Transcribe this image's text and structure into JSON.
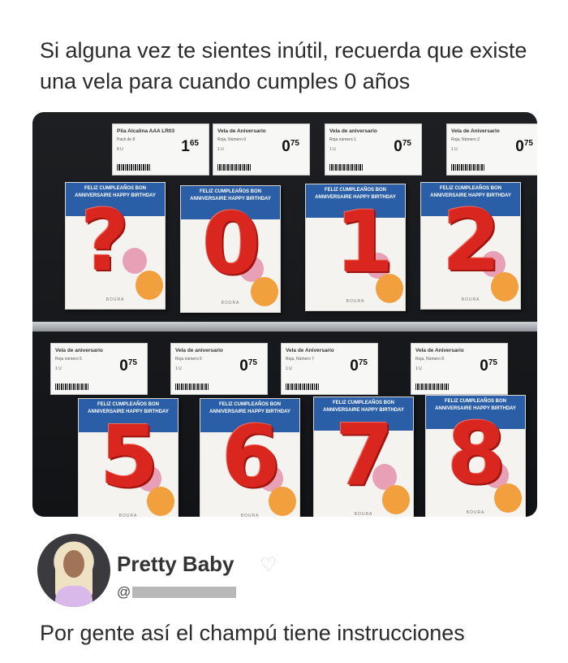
{
  "post": {
    "caption": "Si alguna vez te sientes inútil, recuerda que existe una vela para cuando cumples 0 años"
  },
  "photo": {
    "top_row_tags": [
      {
        "name": "Pila Alcalina AAA LR03",
        "line1": "Pack de 8",
        "line2": "8 U",
        "price": "1",
        "cents": "65"
      },
      {
        "name": "Vela de Aniversario",
        "line1": "Roja, Número 0",
        "line2": "1 U",
        "price": "0",
        "cents": "75"
      },
      {
        "name": "Vela de aniversario",
        "line1": "Roja número 1",
        "line2": "1 U",
        "price": "0",
        "cents": "75"
      },
      {
        "name": "Vela de Aniversario",
        "line1": "Roja, Número 2",
        "line2": "1 U",
        "price": "0",
        "cents": "75"
      }
    ],
    "bottom_row_tags": [
      {
        "name": "Vela de aniversario",
        "line1": "Roja número 5",
        "line2": "1 U",
        "price": "0",
        "cents": "75"
      },
      {
        "name": "Vela de aniversario",
        "line1": "Roja número 6",
        "line2": "1 U",
        "price": "0",
        "cents": "75"
      },
      {
        "name": "Vela de Aniversario",
        "line1": "Roja, Número 7",
        "line2": "1 U",
        "price": "0",
        "cents": "75"
      },
      {
        "name": "Vela de Aniversario",
        "line1": "Roja, Número 8",
        "line2": "1 U",
        "price": "0",
        "cents": "75"
      }
    ],
    "top_row_digits": [
      "?",
      "0",
      "1",
      "2"
    ],
    "bottom_row_digits": [
      "5",
      "6",
      "7",
      "8"
    ],
    "card_band_text": "FELIZ CUMPLEAÑOS BON ANNIVERSAIRE HAPPY BIRTHDAY",
    "brand": "BOURA"
  },
  "profile": {
    "display_name": "Pretty Baby",
    "heart_icon": "white-heart-icon",
    "handle_prefix": "@"
  },
  "comment": {
    "text": "Por gente así el champú tiene instrucciones"
  },
  "colors": {
    "candle_red": "#d9261f",
    "card_band_blue": "#2a5fa8",
    "text_dark": "#2b2b2b"
  }
}
